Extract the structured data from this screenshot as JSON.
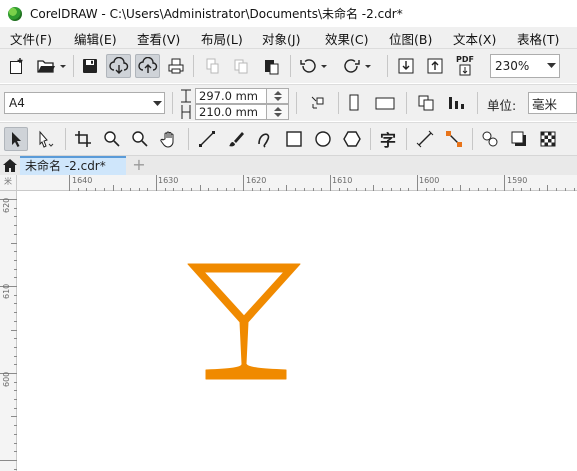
{
  "window": {
    "title": "CorelDRAW - C:\\Users\\Administrator\\Documents\\未命名 -2.cdr*"
  },
  "menu": [
    {
      "label": "文件(F)",
      "name": "menu-file"
    },
    {
      "label": "编辑(E)",
      "name": "menu-edit"
    },
    {
      "label": "查看(V)",
      "name": "menu-view"
    },
    {
      "label": "布局(L)",
      "name": "menu-layout"
    },
    {
      "label": "对象(J)",
      "name": "menu-object"
    },
    {
      "label": "效果(C)",
      "name": "menu-effects"
    },
    {
      "label": "位图(B)",
      "name": "menu-bitmaps"
    },
    {
      "label": "文本(X)",
      "name": "menu-text"
    },
    {
      "label": "表格(T)",
      "name": "menu-table"
    }
  ],
  "standard_toolbar": {
    "icons": [
      "new-document-icon",
      "open-icon",
      "save-icon",
      "cloud-download-icon",
      "cloud-upload-icon",
      "print-icon",
      "cut-icon",
      "copy-icon",
      "paste-icon",
      "undo-icon",
      "redo-icon",
      "import-icon",
      "export-icon",
      "export-pdf-icon"
    ],
    "pdf_label": "PDF",
    "zoom_level": "230%"
  },
  "property_bar": {
    "page_size": "A4",
    "width": "297.0 mm",
    "height": "210.0 mm",
    "units_label": "单位:",
    "units_value": "毫米"
  },
  "toolbox": {
    "icons": [
      "pick-tool-icon",
      "shape-tool-icon",
      "crop-tool-icon",
      "zoom-tool-icon",
      "zoom-out-icon",
      "pan-tool-icon",
      "freehand-tool-icon",
      "artistic-media-icon",
      "bezier-tool-icon",
      "rectangle-tool-icon",
      "ellipse-tool-icon",
      "polygon-tool-icon",
      "text-tool-icon",
      "dimension-tool-icon",
      "connector-tool-icon",
      "blend-tool-icon",
      "drop-shadow-icon",
      "transparency-tool-icon"
    ],
    "text_tool_glyph": "字"
  },
  "document_tabs": {
    "active_tab": "未命名 -2.cdr*",
    "add_tab": "+"
  },
  "rulers": {
    "horizontal_ticks": [
      "1640",
      "1630",
      "1620",
      "1610",
      "1600",
      "1590"
    ],
    "vertical_ticks": [
      "620",
      "610",
      "600"
    ],
    "units_glyph": "米"
  },
  "canvas": {
    "shape": "cocktail-glass-icon",
    "shape_color": "#F08A00"
  }
}
